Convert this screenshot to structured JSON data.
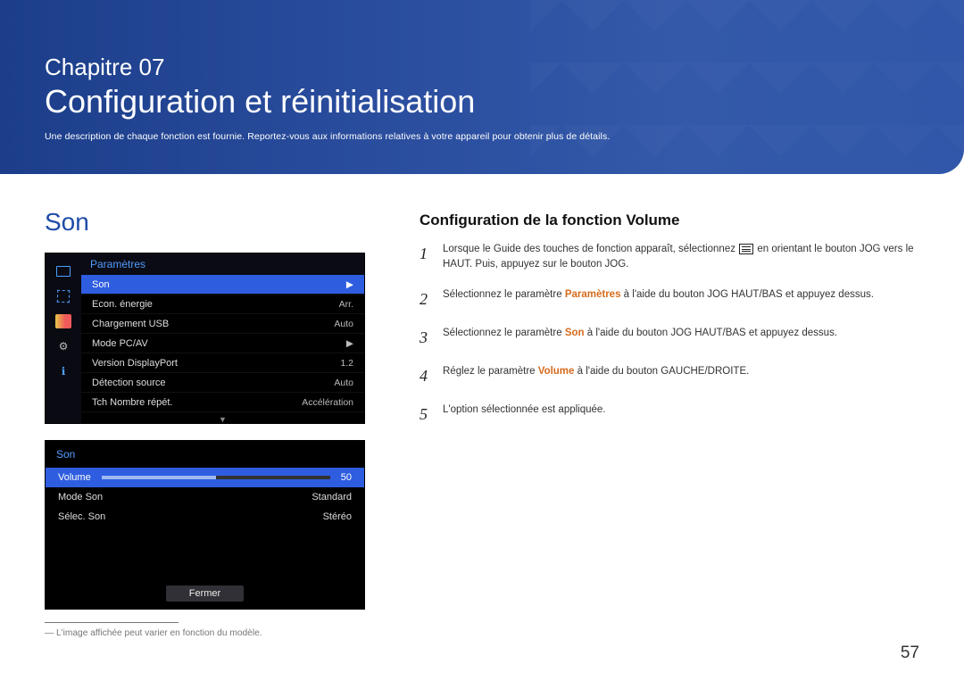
{
  "banner": {
    "chapter": "Chapitre 07",
    "title": "Configuration et réinitialisation",
    "subtitle": "Une description de chaque fonction est fournie. Reportez-vous aux informations relatives à votre appareil pour obtenir plus de détails."
  },
  "left": {
    "section_title": "Son",
    "osd1_title": "Paramètres",
    "osd1_rows": [
      {
        "label": "Son",
        "value": "",
        "type": "selected-caret"
      },
      {
        "label": "Econ. énergie",
        "value": "Arr."
      },
      {
        "label": "Chargement USB",
        "value": "Auto"
      },
      {
        "label": "Mode PC/AV",
        "value": "",
        "type": "caret"
      },
      {
        "label": "Version DisplayPort",
        "value": "1.2"
      },
      {
        "label": "Détection source",
        "value": "Auto"
      },
      {
        "label": "Tch Nombre répét.",
        "value": "Accélération"
      }
    ],
    "osd2_title": "Son",
    "osd2_volume_label": "Volume",
    "osd2_volume_value": "50",
    "osd2_rows": [
      {
        "label": "Mode Son",
        "value": "Standard"
      },
      {
        "label": "Sélec. Son",
        "value": "Stéréo"
      }
    ],
    "osd2_close": "Fermer",
    "footnote": "L'image affichée peut varier en fonction du modèle."
  },
  "right": {
    "heading": "Configuration de la fonction Volume",
    "steps": [
      {
        "n": "1",
        "pre": "Lorsque le Guide des touches de fonction apparaît, sélectionnez ",
        "post": " en orientant le bouton JOG vers le HAUT. Puis, appuyez sur le bouton JOG.",
        "icon": true
      },
      {
        "n": "2",
        "pre": "Sélectionnez le paramètre ",
        "kw": "Paramètres",
        "post": " à l'aide du bouton JOG HAUT/BAS et appuyez dessus."
      },
      {
        "n": "3",
        "pre": "Sélectionnez le paramètre ",
        "kw": "Son",
        "post": " à l'aide du bouton JOG HAUT/BAS et appuyez dessus."
      },
      {
        "n": "4",
        "pre": "Réglez le paramètre ",
        "kw": "Volume",
        "post": " à l'aide du bouton GAUCHE/DROITE."
      },
      {
        "n": "5",
        "pre": "L'option sélectionnée est appliquée."
      }
    ]
  },
  "page_number": "57"
}
